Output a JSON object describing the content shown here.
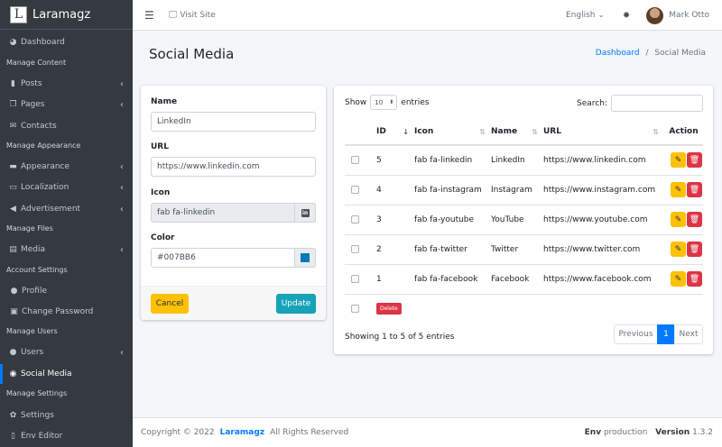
{
  "brand": {
    "logo_letter": "L",
    "name": "Laramagz"
  },
  "sidebar": {
    "items": [
      {
        "label": "Dashboard",
        "icon": "palette-icon"
      },
      {
        "header": "Manage Content"
      },
      {
        "label": "Posts",
        "icon": "book-icon"
      },
      {
        "label": "Pages",
        "icon": "copy-icon"
      },
      {
        "label": "Contacts",
        "icon": "envelope-icon"
      },
      {
        "header": "Manage Appearance"
      },
      {
        "label": "Appearance",
        "icon": "paint-roller-icon"
      },
      {
        "label": "Localization",
        "icon": "language-icon"
      },
      {
        "label": "Advertisement",
        "icon": "bullhorn-icon"
      },
      {
        "header": "Manage Files"
      },
      {
        "label": "Media",
        "icon": "photo-video-icon"
      },
      {
        "header": "Account Settings"
      },
      {
        "label": "Profile",
        "icon": "user-icon"
      },
      {
        "label": "Change Password",
        "icon": "lock-icon"
      },
      {
        "header": "Manage Users"
      },
      {
        "label": "Users",
        "icon": "users-icon"
      },
      {
        "label": "Social Media",
        "icon": "globe-icon"
      },
      {
        "header": "Manage Settings"
      },
      {
        "label": "Settings",
        "icon": "cogs-icon"
      },
      {
        "label": "Env Editor",
        "icon": "file-icon"
      }
    ]
  },
  "topbar": {
    "visit_site": "Visit Site",
    "language": "English",
    "user_name": "Mark Otto"
  },
  "page": {
    "title": "Social Media",
    "breadcrumb_home": "Dashboard",
    "breadcrumb_sep": "/",
    "breadcrumb_current": "Social Media"
  },
  "form": {
    "name_label": "Name",
    "name_value": "LinkedIn",
    "url_label": "URL",
    "url_value": "https://www.linkedin.com",
    "icon_label": "Icon",
    "icon_value": "fab fa-linkedin",
    "color_label": "Color",
    "color_value": "#007BB6",
    "cancel_label": "Cancel",
    "update_label": "Update"
  },
  "table": {
    "show_label": "Show",
    "entries_value": "10",
    "entries_label": "entries",
    "search_label": "Search:",
    "columns": {
      "id": "ID",
      "icon": "Icon",
      "name": "Name",
      "url": "URL",
      "action": "Action"
    },
    "rows": [
      {
        "id": "5",
        "icon": "fab fa-linkedin",
        "name": "LinkedIn",
        "url": "https://www.linkedin.com"
      },
      {
        "id": "4",
        "icon": "fab fa-instagram",
        "name": "Instagram",
        "url": "https://www.instagram.com"
      },
      {
        "id": "3",
        "icon": "fab fa-youtube",
        "name": "YouTube",
        "url": "https://www.youtube.com"
      },
      {
        "id": "2",
        "icon": "fab fa-twitter",
        "name": "Twitter",
        "url": "https://www.twitter.com"
      },
      {
        "id": "1",
        "icon": "fab fa-facebook",
        "name": "Facebook",
        "url": "https://www.facebook.com"
      }
    ],
    "delete_label": "Delete",
    "showing_text": "Showing 1 to 5 of 5 entries",
    "pager": {
      "previous": "Previous",
      "page": "1",
      "next": "Next"
    }
  },
  "footer": {
    "copyright": "Copyright © 2022",
    "brand": "Laramagz",
    "rights": "All Rights Reserved",
    "env_label": "Env",
    "env_value": "production",
    "version_label": "Version",
    "version_value": "1.3.2"
  },
  "colors": {
    "accent": "#007bff",
    "sidebar_bg": "#343a40",
    "cancel": "#ffc107",
    "update": "#17a2b8",
    "danger": "#dc3545",
    "swatch": "#007BB6"
  }
}
